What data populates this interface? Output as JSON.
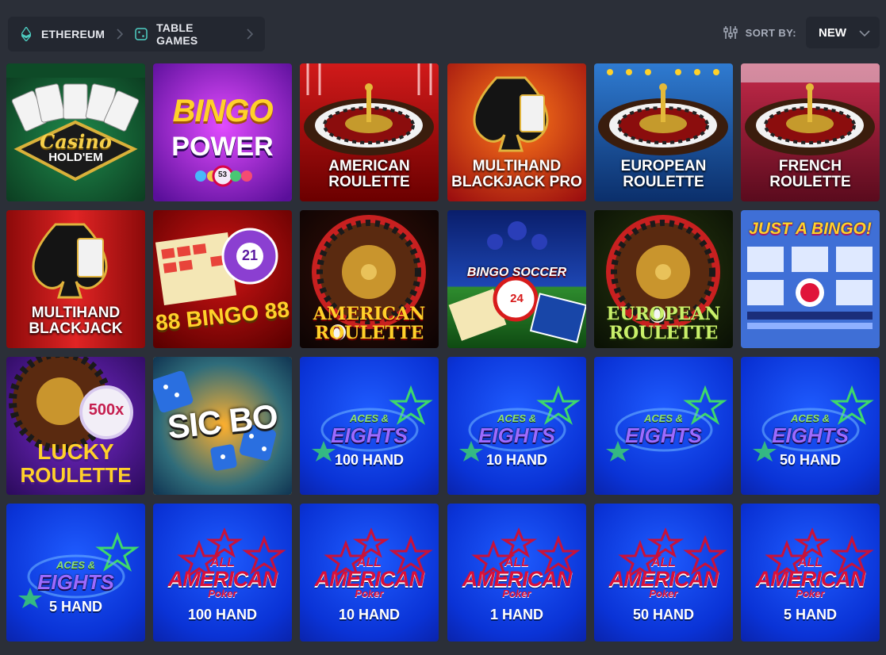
{
  "breadcrumb": {
    "items": [
      {
        "label": "ETHEREUM",
        "icon": "ethereum-icon"
      },
      {
        "label": "TABLE GAMES",
        "icon": "dice-icon"
      }
    ]
  },
  "sort": {
    "label": "SORT BY:",
    "selected": "NEW",
    "icon": "sliders-icon"
  },
  "games": [
    {
      "id": "casino-holdem",
      "line1": "Casino",
      "line2": "HOLD'EM"
    },
    {
      "id": "bingo-power",
      "line1": "BINGO",
      "line2": "POWER",
      "ball": "53"
    },
    {
      "id": "american-roulette-1",
      "title": "AMERICAN\nROULETTE"
    },
    {
      "id": "multihand-blackjack-pro",
      "title": "MULTIHAND\nBLACKJACK PRO"
    },
    {
      "id": "european-roulette-1",
      "title": "EUROPEAN\nROULETTE"
    },
    {
      "id": "french-roulette",
      "title": "FRENCH\nROULETTE"
    },
    {
      "id": "multihand-blackjack",
      "title": "MULTIHAND\nBLACKJACK"
    },
    {
      "id": "88-bingo-88",
      "title": "88 BINGO 88",
      "ball": "21"
    },
    {
      "id": "american-roulette-2",
      "line1": "AMERICAN",
      "line2": "ROULETTE"
    },
    {
      "id": "bingo-soccer",
      "title": "BINGO SOCCER",
      "ball": "24"
    },
    {
      "id": "european-roulette-2",
      "line1": "EUROPEAN",
      "line2": "ROULETTE"
    },
    {
      "id": "just-a-bingo",
      "title": "JUST A BINGO!"
    },
    {
      "id": "lucky-roulette",
      "line1": "LUCKY",
      "line2": "ROULETTE",
      "badge": "500x"
    },
    {
      "id": "sic-bo",
      "title": "SIC BO"
    },
    {
      "id": "aces-eights-100",
      "brand1": "ACES &",
      "brand2": "EIGHTS",
      "hand": "100 HAND"
    },
    {
      "id": "aces-eights-10",
      "brand1": "ACES &",
      "brand2": "EIGHTS",
      "hand": "10 HAND"
    },
    {
      "id": "aces-eights-1",
      "brand1": "ACES &",
      "brand2": "EIGHTS",
      "hand": ""
    },
    {
      "id": "aces-eights-50",
      "brand1": "ACES &",
      "brand2": "EIGHTS",
      "hand": "50 HAND"
    },
    {
      "id": "aces-eights-5",
      "brand1": "ACES &",
      "brand2": "EIGHTS",
      "hand": "5 HAND"
    },
    {
      "id": "all-american-100",
      "brand0": "ALL",
      "brand1": "AMERICAN",
      "brand2": "Poker",
      "hand": "100 HAND"
    },
    {
      "id": "all-american-10",
      "brand0": "ALL",
      "brand1": "AMERICAN",
      "brand2": "Poker",
      "hand": "10 HAND"
    },
    {
      "id": "all-american-1",
      "brand0": "ALL",
      "brand1": "AMERICAN",
      "brand2": "Poker",
      "hand": "1 HAND"
    },
    {
      "id": "all-american-50",
      "brand0": "ALL",
      "brand1": "AMERICAN",
      "brand2": "Poker",
      "hand": "50 HAND"
    },
    {
      "id": "all-american-5",
      "brand0": "ALL",
      "brand1": "AMERICAN",
      "brand2": "Poker",
      "hand": "5 HAND"
    }
  ]
}
